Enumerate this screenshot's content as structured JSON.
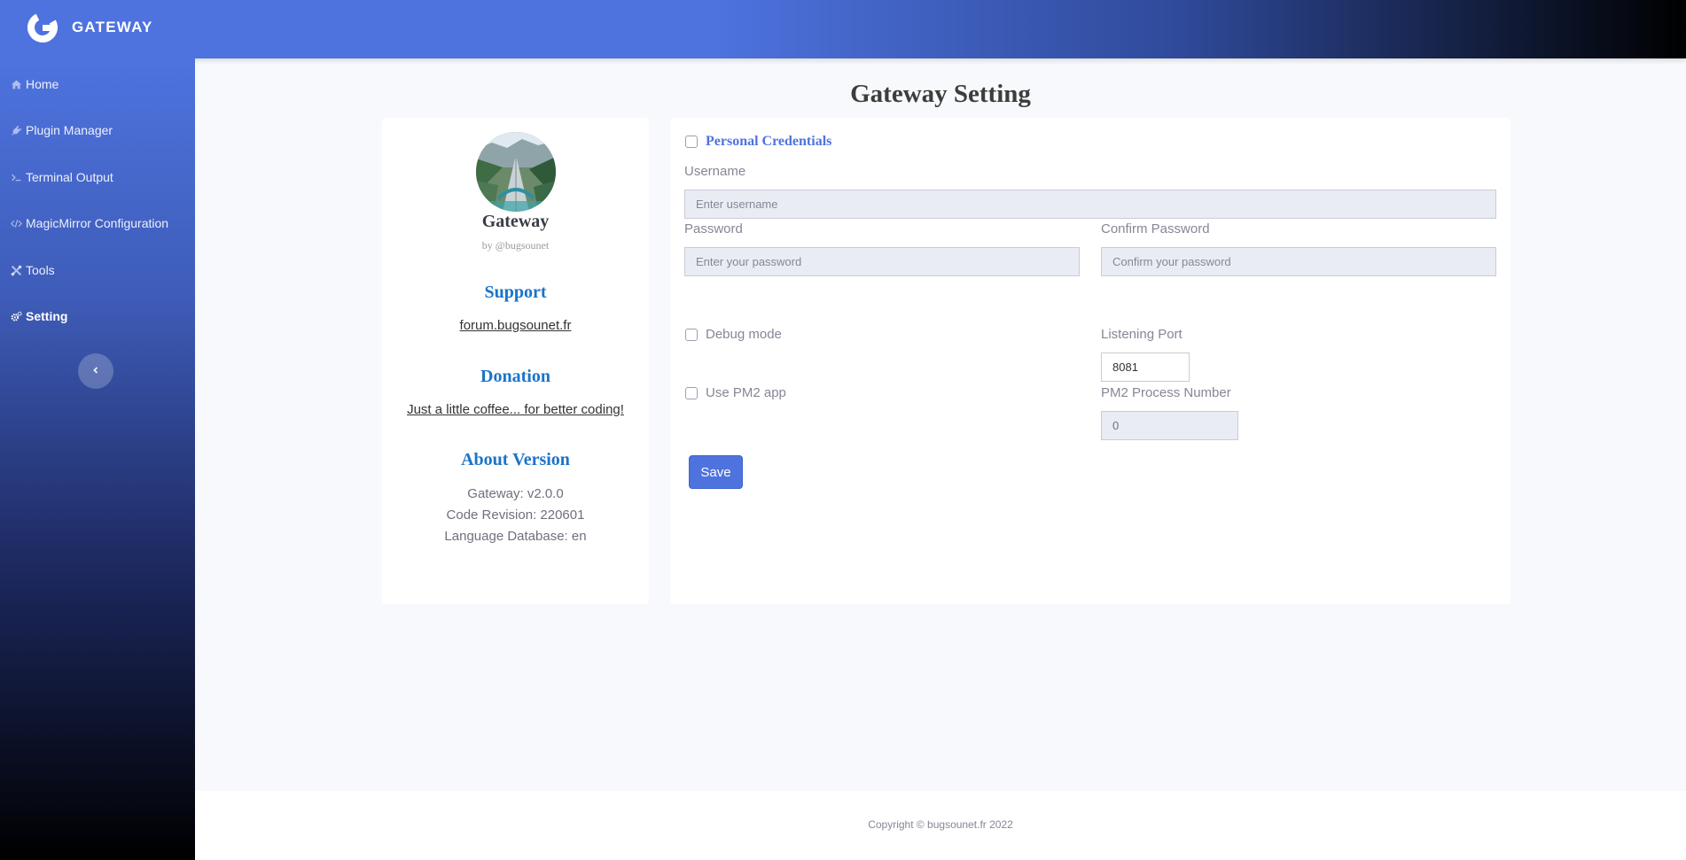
{
  "brand": {
    "name": "GATEWAY",
    "logo_icon": "g-logo-icon"
  },
  "sidebar": {
    "items": [
      {
        "label": "Home",
        "icon": "home-icon"
      },
      {
        "label": "Plugin Manager",
        "icon": "plug-icon"
      },
      {
        "label": "Terminal Output",
        "icon": "terminal-icon"
      },
      {
        "label": "MagicMirror Configuration",
        "icon": "code-icon"
      },
      {
        "label": "Tools",
        "icon": "tools-icon"
      },
      {
        "label": "Setting",
        "icon": "cogs-icon",
        "active": true
      }
    ],
    "collapse_icon": "chevron-left-icon"
  },
  "page": {
    "title": "Gateway Setting"
  },
  "profile": {
    "name": "Gateway",
    "by": "by @bugsounet",
    "support_heading": "Support",
    "support_link": "forum.bugsounet.fr",
    "donation_heading": "Donation",
    "donation_link": "Just a little coffee... for better coding!",
    "about_heading": "About Version",
    "version": "Gateway: v2.0.0",
    "revision": "Code Revision: 220601",
    "language": "Language Database: en"
  },
  "settings": {
    "credentials_label": "Personal Credentials",
    "username_label": "Username",
    "username_placeholder": "Enter username",
    "password_label": "Password",
    "password_placeholder": "Enter your password",
    "confirm_label": "Confirm Password",
    "confirm_placeholder": "Confirm your password",
    "debug_label": "Debug mode",
    "port_label": "Listening Port",
    "port_value": "8081",
    "pm2_label": "Use PM2 app",
    "pm2_number_label": "PM2 Process Number",
    "pm2_number_value": "0",
    "save_label": "Save"
  },
  "footer": {
    "copyright": "Copyright © bugsounet.fr 2022"
  },
  "colors": {
    "primary": "#4e73df",
    "heading_blue": "#1a74c9",
    "page_bg": "#f8f9fc"
  }
}
